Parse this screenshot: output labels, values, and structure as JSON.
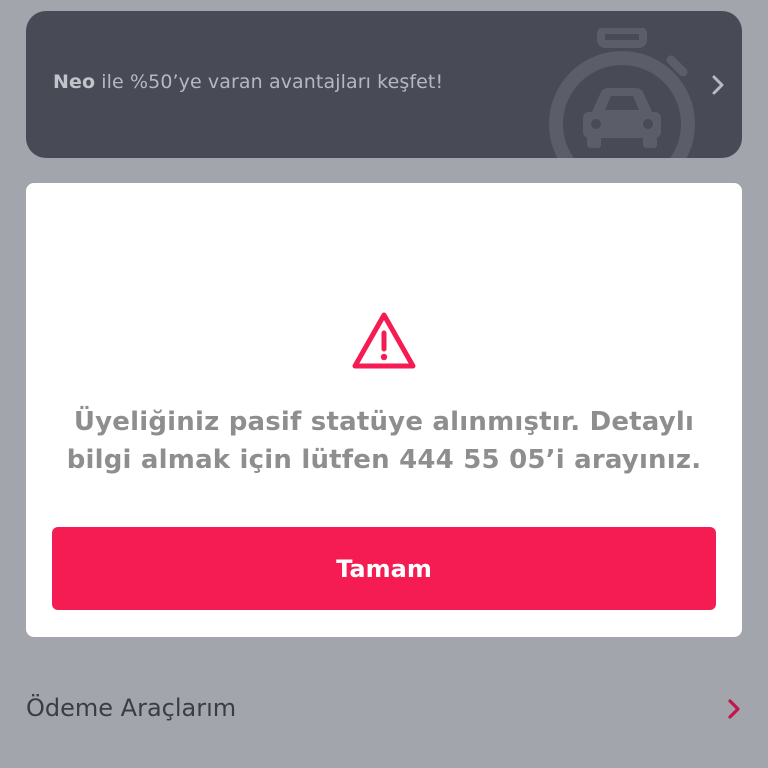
{
  "promo_banner": {
    "brand": "Neo",
    "text": " ile %50’ye varan avantajları keşfet!",
    "illustration_icon": "stopwatch-car-icon",
    "chevron_icon": "chevron-right-icon"
  },
  "alert_modal": {
    "icon": "warning-triangle-icon",
    "message": "Üyeliğiniz pasif statüye alınmıştır. Detaylı bilgi almak için lütfen 444 55 05’i arayınız.",
    "ok_button_label": "Tamam"
  },
  "menu": {
    "items": [
      {
        "label": "Ödeme Araçlarım",
        "icon": "chevron-right-icon"
      }
    ]
  },
  "colors": {
    "accent": "#f41c52",
    "overlay_background": "#a3a5ac",
    "banner_background": "#484a56",
    "modal_background": "#ffffff",
    "message_text": "#8e8e8e"
  }
}
